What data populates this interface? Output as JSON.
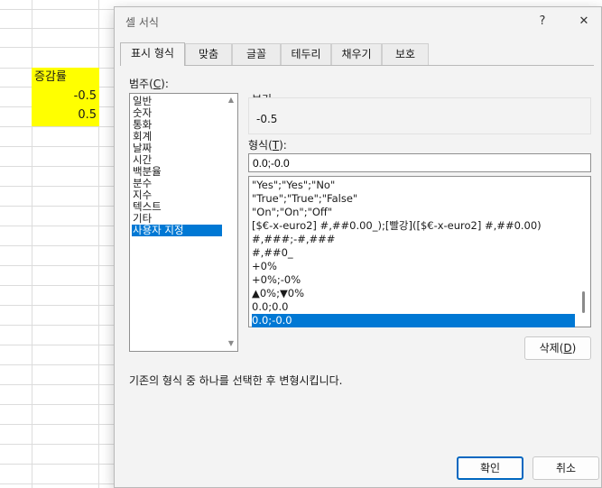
{
  "sheet": {
    "header_cell": "증감률",
    "values": [
      "-0.5",
      "0.5"
    ]
  },
  "dialog": {
    "title": "셀 서식",
    "help_glyph": "?",
    "close_glyph": "✕",
    "tabs": [
      "표시 형식",
      "맞춤",
      "글꼴",
      "테두리",
      "채우기",
      "보호"
    ],
    "category_label": {
      "prefix": "범주(",
      "key": "C",
      "suffix": "):"
    },
    "categories": [
      "일반",
      "숫자",
      "통화",
      "회계",
      "날짜",
      "시간",
      "백분율",
      "분수",
      "지수",
      "텍스트",
      "기타",
      "사용자 지정"
    ],
    "sample_label": "보기",
    "sample_value": "-0.5",
    "format_label": {
      "prefix": "형식(",
      "key": "T",
      "suffix": "):"
    },
    "format_input": "0.0;-0.0",
    "formats": [
      "\"Yes\";\"Yes\";\"No\"",
      "\"True\";\"True\";\"False\"",
      "\"On\";\"On\";\"Off\"",
      "[$€-x-euro2] #,##0.00_);[빨강]([$€-x-euro2] #,##0.00)",
      "#,###;-#,###",
      "#,##0_",
      "+0%",
      "+0%;-0%",
      "▲0%;▼0%",
      "0.0;0.0",
      "0.0;-0.0"
    ],
    "delete_button": {
      "prefix": "삭제(",
      "key": "D",
      "suffix": ")"
    },
    "description": "기존의 형식 중 하나를 선택한 후 변형시킵니다.",
    "ok_button": "확인",
    "cancel_button": "취소"
  },
  "colors": {
    "accent": "#0078d4",
    "highlight_cell": "#ffff00"
  },
  "icons": {
    "help": "question-mark-icon",
    "close": "close-icon",
    "scroll_up": "triangle-up-icon",
    "scroll_down": "triangle-down-icon"
  }
}
